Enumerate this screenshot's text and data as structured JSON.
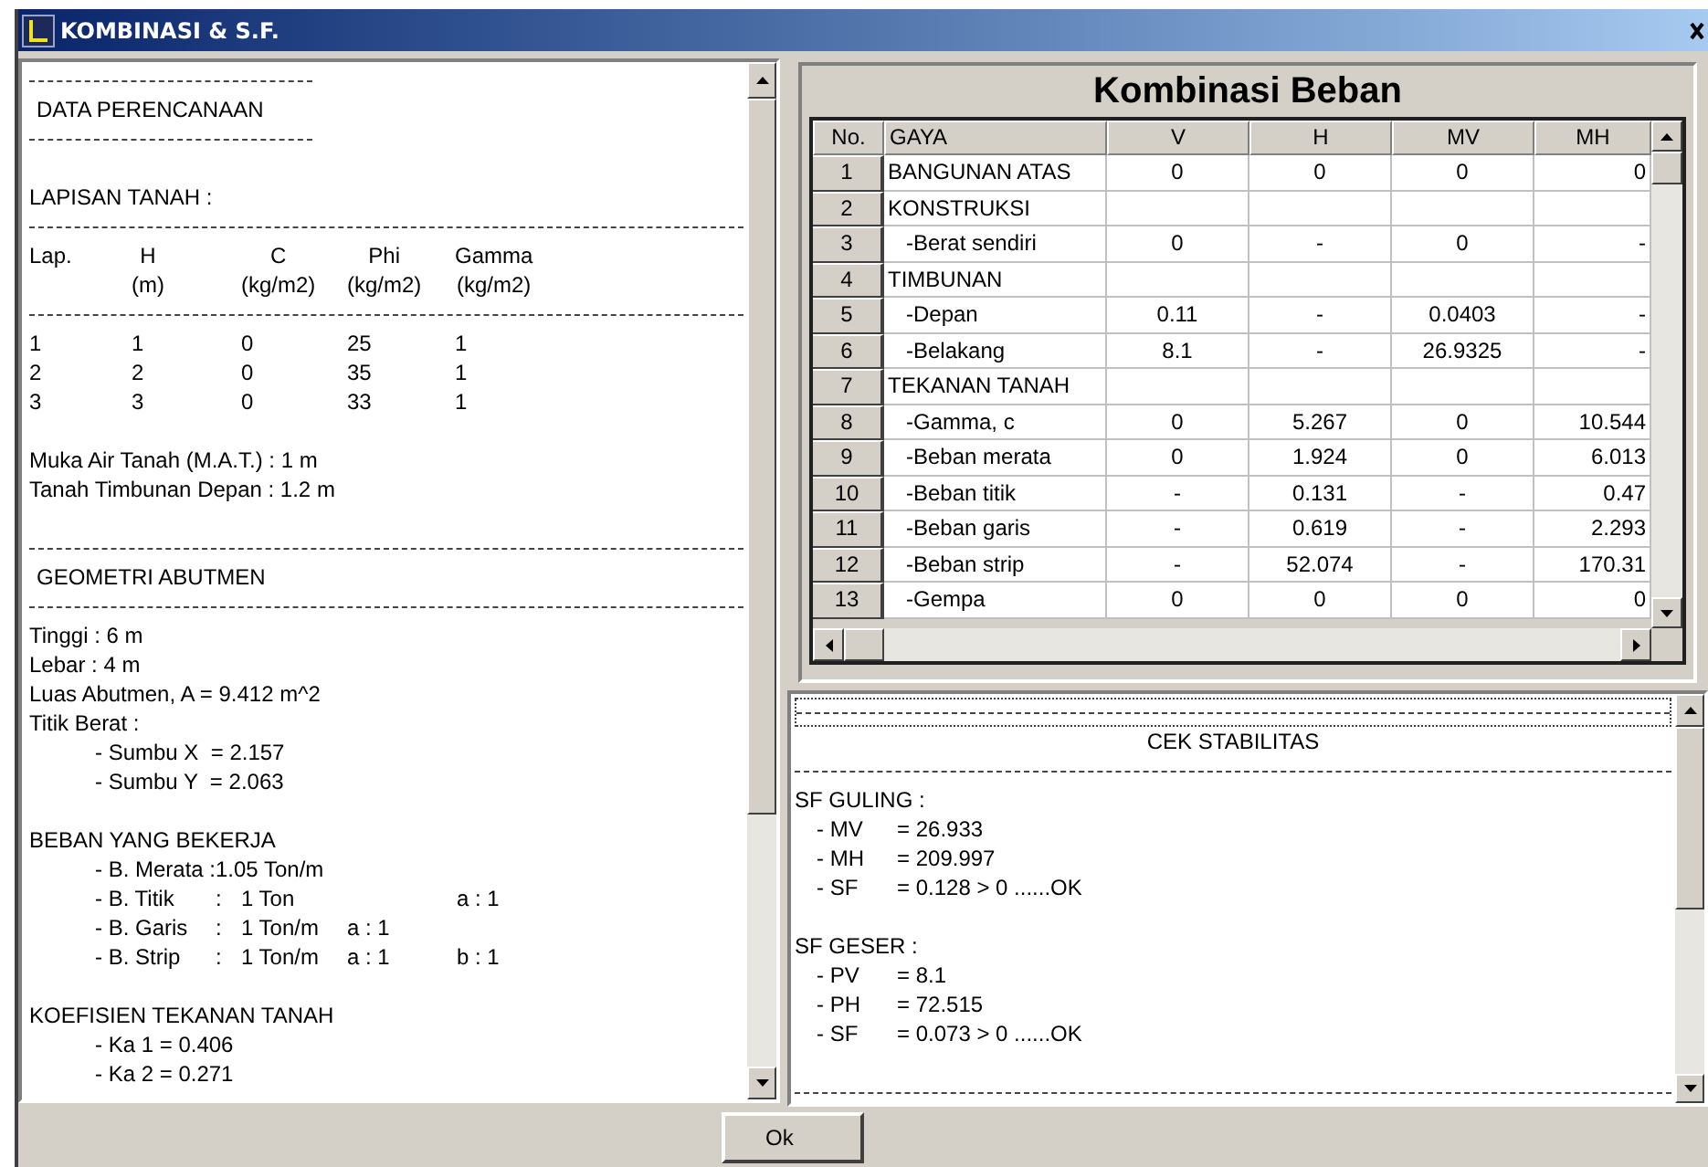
{
  "window": {
    "title": "KOMBINASI & S.F."
  },
  "report": {
    "lines": [
      {
        "kind": "short_rule"
      },
      {
        "kind": "heading",
        "text": "DATA PERENCANAAN"
      },
      {
        "kind": "short_rule"
      },
      {
        "kind": "blank"
      },
      {
        "kind": "text",
        "text": "LAPISAN TANAH :"
      },
      {
        "kind": "rule"
      },
      {
        "kind": "table",
        "columns": [
          {
            "title": "Lap."
          },
          {
            "title": "H",
            "unit": "(m)"
          },
          {
            "title": "C",
            "unit": "(kg/m2)"
          },
          {
            "title": "Phi",
            "unit": "(kg/m2)"
          },
          {
            "title": "Gamma",
            "unit": "(kg/m2)"
          }
        ],
        "rows": [
          [
            "1",
            "1",
            "0",
            "25",
            "1"
          ],
          [
            "2",
            "2",
            "0",
            "35",
            "1"
          ],
          [
            "3",
            "3",
            "0",
            "33",
            "1"
          ]
        ]
      },
      {
        "kind": "blank"
      },
      {
        "kind": "text",
        "text": "Muka Air Tanah (M.A.T.) : 1 m"
      },
      {
        "kind": "text",
        "text": "Tanah Timbunan Depan : 1.2 m"
      },
      {
        "kind": "blank"
      },
      {
        "kind": "rule"
      },
      {
        "kind": "heading",
        "text": "GEOMETRI ABUTMEN"
      },
      {
        "kind": "rule"
      },
      {
        "kind": "text",
        "text": "Tinggi : 6 m"
      },
      {
        "kind": "text",
        "text": "Lebar : 4 m"
      },
      {
        "kind": "text",
        "text": "Luas Abutmen, A = 9.412 m^2"
      },
      {
        "kind": "text",
        "text": "Titik Berat :"
      },
      {
        "kind": "item",
        "text": "- Sumbu X  = 2.157"
      },
      {
        "kind": "item",
        "text": "- Sumbu Y  = 2.063"
      },
      {
        "kind": "blank"
      },
      {
        "kind": "text",
        "text": "BEBAN YANG BEKERJA"
      },
      {
        "kind": "load",
        "label": "- B. Merata :",
        "value": "1.05 Ton/m"
      },
      {
        "kind": "load",
        "label": "- B. Titik",
        "sep": ":",
        "value": "1 Ton",
        "far": "a : 1"
      },
      {
        "kind": "load",
        "label": "- B. Garis",
        "sep": ":",
        "value": "1 Ton/m",
        "a": "a : 1"
      },
      {
        "kind": "load",
        "label": "- B. Strip",
        "sep": ":",
        "value": "1 Ton/m",
        "a": "a : 1",
        "far": "b : 1"
      },
      {
        "kind": "blank"
      },
      {
        "kind": "text",
        "text": "KOEFISIEN TEKANAN TANAH"
      },
      {
        "kind": "item",
        "text": "- Ka 1 = 0.406"
      },
      {
        "kind": "item",
        "text": "- Ka 2 = 0.271"
      }
    ]
  },
  "grid": {
    "title": "Kombinasi Beban",
    "columns": [
      "No.",
      "GAYA",
      "V",
      "H",
      "MV",
      "MH"
    ],
    "rows": [
      {
        "no": "1",
        "kind": "group",
        "gaya": "BANGUNAN ATAS",
        "values": [
          "0",
          "0",
          "0",
          "0"
        ]
      },
      {
        "no": "2",
        "kind": "group",
        "gaya": "KONSTRUKSI"
      },
      {
        "no": "3",
        "kind": "item",
        "gaya": "-Berat sendiri",
        "values": [
          "0",
          "-",
          "0",
          "-"
        ]
      },
      {
        "no": "4",
        "kind": "group",
        "gaya": "TIMBUNAN"
      },
      {
        "no": "5",
        "kind": "item",
        "gaya": "-Depan",
        "values": [
          "0.11",
          "-",
          "0.0403",
          "-"
        ]
      },
      {
        "no": "6",
        "kind": "item",
        "gaya": "-Belakang",
        "values": [
          "8.1",
          "-",
          "26.9325",
          "-"
        ]
      },
      {
        "no": "7",
        "kind": "group",
        "gaya": "TEKANAN TANAH"
      },
      {
        "no": "8",
        "kind": "item",
        "gaya": "-Gamma, c",
        "values": [
          "0",
          "5.267",
          "0",
          "10.544"
        ]
      },
      {
        "no": "9",
        "kind": "item",
        "gaya": "-Beban merata",
        "values": [
          "0",
          "1.924",
          "0",
          "6.013"
        ]
      },
      {
        "no": "10",
        "kind": "item",
        "gaya": "-Beban titik",
        "values": [
          "-",
          "0.131",
          "-",
          "0.47"
        ]
      },
      {
        "no": "11",
        "kind": "item",
        "gaya": "-Beban garis",
        "values": [
          "-",
          "0.619",
          "-",
          "2.293"
        ]
      },
      {
        "no": "12",
        "kind": "item",
        "gaya": "-Beban strip",
        "values": [
          "-",
          "52.074",
          "-",
          "170.31"
        ]
      },
      {
        "no": "13",
        "kind": "item",
        "gaya": "-Gempa",
        "values": [
          "0",
          "0",
          "0",
          "0"
        ]
      }
    ]
  },
  "stability": {
    "lines": [
      {
        "kind": "focus_rule"
      },
      {
        "kind": "center",
        "text": "CEK STABILITAS"
      },
      {
        "kind": "rule"
      },
      {
        "kind": "text",
        "text": "SF GULING :"
      },
      {
        "kind": "pair",
        "label": "- MV",
        "value": "= 26.933"
      },
      {
        "kind": "pair",
        "label": "- MH",
        "value": "= 209.997"
      },
      {
        "kind": "pair",
        "label": "- SF",
        "value": "= 0.128 > 0 ......OK"
      },
      {
        "kind": "blank"
      },
      {
        "kind": "text",
        "text": "SF GESER :"
      },
      {
        "kind": "pair",
        "label": "- PV",
        "value": "= 8.1"
      },
      {
        "kind": "pair",
        "label": "- PH",
        "value": "= 72.515"
      },
      {
        "kind": "pair",
        "label": "- SF",
        "value": "= 0.073 > 0 ......OK"
      },
      {
        "kind": "blank"
      },
      {
        "kind": "rule"
      }
    ]
  },
  "buttons": [
    "Ok"
  ]
}
